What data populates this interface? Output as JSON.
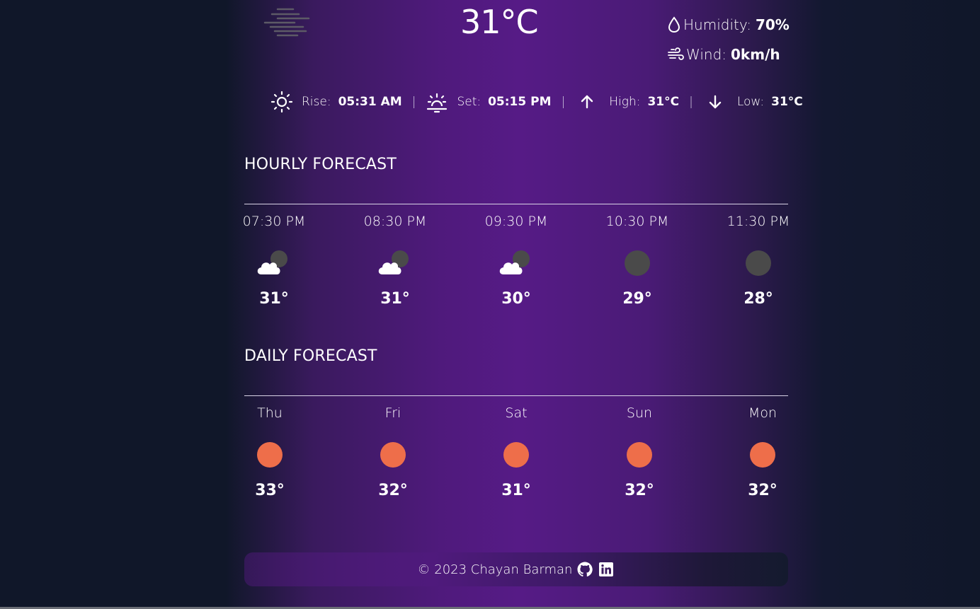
{
  "current": {
    "temperature": "31°C",
    "humidity_label": "Humidity:",
    "humidity_value": "70%",
    "wind_label": "Wind:",
    "wind_value": "0km/h",
    "icon": "haze-icon"
  },
  "details": {
    "rise_label": "Rise:",
    "rise_value": "05:31 AM",
    "set_label": "Set:",
    "set_value": "05:15 PM",
    "high_label": "High:",
    "high_value": "31°C",
    "low_label": "Low:",
    "low_value": "31°C",
    "separator": "|"
  },
  "hourly": {
    "title": "HOURLY FORECAST",
    "items": [
      {
        "time": "07:30 PM",
        "icon": "partly-cloudy-night-icon",
        "temp": "31°"
      },
      {
        "time": "08:30 PM",
        "icon": "partly-cloudy-night-icon",
        "temp": "31°"
      },
      {
        "time": "09:30 PM",
        "icon": "partly-cloudy-night-icon",
        "temp": "30°"
      },
      {
        "time": "10:30 PM",
        "icon": "clear-night-icon",
        "temp": "29°"
      },
      {
        "time": "11:30 PM",
        "icon": "clear-night-icon",
        "temp": "28°"
      }
    ]
  },
  "daily": {
    "title": "DAILY FORECAST",
    "items": [
      {
        "day": "Thu",
        "icon": "sun-icon",
        "temp": "33°"
      },
      {
        "day": "Fri",
        "icon": "sun-icon",
        "temp": "32°"
      },
      {
        "day": "Sat",
        "icon": "sun-icon",
        "temp": "31°"
      },
      {
        "day": "Sun",
        "icon": "sun-icon",
        "temp": "32°"
      },
      {
        "day": "Mon",
        "icon": "sun-icon",
        "temp": "32°"
      }
    ]
  },
  "footer": {
    "copyright": "© 2023 Chayan Barman",
    "links": [
      "github-icon",
      "linkedin-icon"
    ]
  },
  "colors": {
    "sun": "#ee6e4a",
    "moon": "#4a4a4a",
    "cloud": "#ffffff"
  }
}
